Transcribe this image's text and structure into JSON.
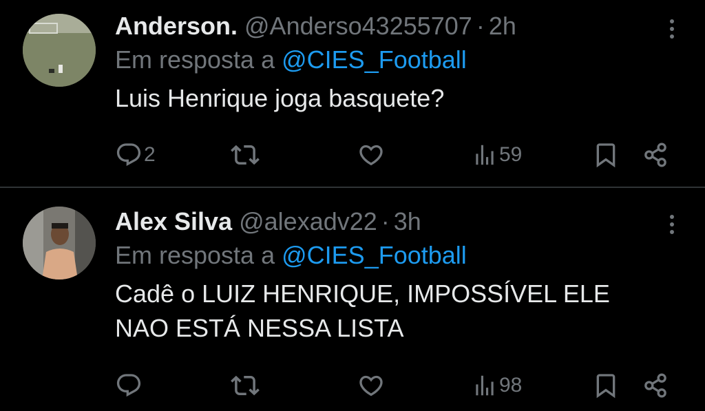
{
  "colors": {
    "background": "#000000",
    "text": "#e7e9ea",
    "muted": "#71767b",
    "link": "#1d9bf0",
    "divider": "#2f3336"
  },
  "tweets": [
    {
      "display_name": "Anderson.",
      "handle": "@Anderso43255707",
      "separator": "·",
      "time": "2h",
      "reply_prefix": "Em resposta a",
      "reply_to": "@CIES_Football",
      "text_lines": [
        "Luis Henrique joga basquete?"
      ],
      "reply_count": "2",
      "retweet_count": "",
      "like_count": "",
      "view_count": "59",
      "avatar_icon": "avatar-grass-field"
    },
    {
      "display_name": "Alex Silva",
      "handle": "@alexadv22",
      "separator": "·",
      "time": "3h",
      "reply_prefix": "Em resposta a",
      "reply_to": "@CIES_Football",
      "text_lines": [
        "Cadê o LUIZ HENRIQUE, IMPOSSÍVEL ELE",
        "NAO ESTÁ NESSA LISTA"
      ],
      "reply_count": "",
      "retweet_count": "",
      "like_count": "",
      "view_count": "98",
      "avatar_icon": "avatar-person-photo"
    }
  ]
}
